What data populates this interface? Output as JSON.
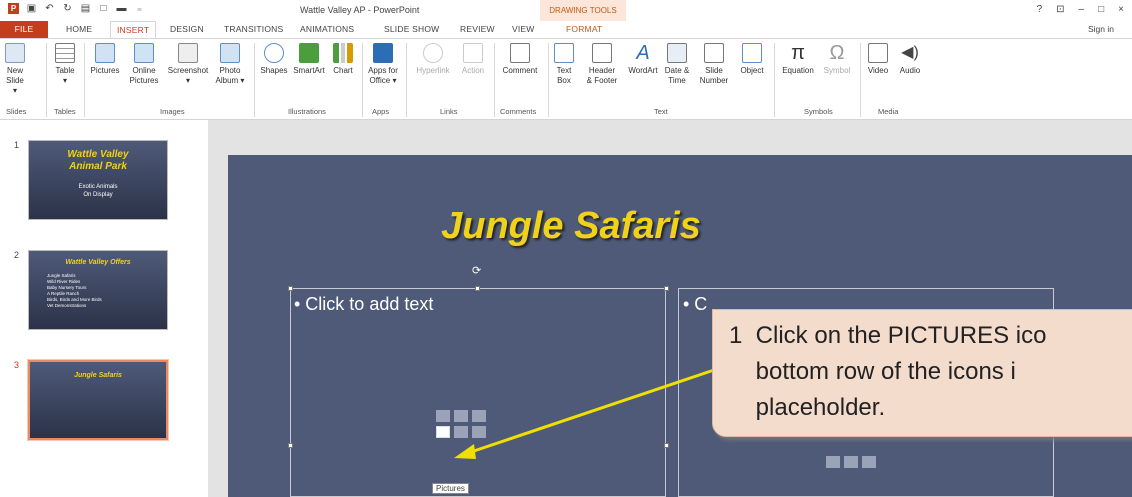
{
  "app": {
    "window_title": "Wattle Valley AP - PowerPoint",
    "contextual_tab_group": "DRAWING TOOLS",
    "sign_in": "Sign in",
    "window_buttons": [
      "?",
      "⊡",
      "–",
      "□",
      "×"
    ]
  },
  "tabs": [
    "FILE",
    "HOME",
    "INSERT",
    "DESIGN",
    "TRANSITIONS",
    "ANIMATIONS",
    "SLIDE SHOW",
    "REVIEW",
    "VIEW",
    "FORMAT"
  ],
  "active_tab": "INSERT",
  "ribbon": {
    "buttons": {
      "new_slide": [
        "New",
        "Slide ▾"
      ],
      "table": [
        "Table",
        "▾"
      ],
      "pictures": "Pictures",
      "online_pictures": [
        "Online",
        "Pictures"
      ],
      "screenshot": [
        "Screenshot",
        "▾"
      ],
      "photo_album": [
        "Photo",
        "Album ▾"
      ],
      "shapes": "Shapes",
      "smartart": "SmartArt",
      "chart": "Chart",
      "apps_for_office": [
        "Apps for",
        "Office ▾"
      ],
      "hyperlink": "Hyperlink",
      "action": "Action",
      "comment": "Comment",
      "text_box": [
        "Text",
        "Box"
      ],
      "header_footer": [
        "Header",
        "& Footer"
      ],
      "wordart": "WordArt",
      "date_time": [
        "Date &",
        "Time"
      ],
      "slide_number": [
        "Slide",
        "Number"
      ],
      "object": "Object",
      "equation": "Equation",
      "symbol": "Symbol",
      "video": "Video",
      "audio": "Audio"
    },
    "groups": [
      "Slides",
      "Tables",
      "Images",
      "Illustrations",
      "Apps",
      "Links",
      "Comments",
      "Text",
      "Symbols",
      "Media"
    ]
  },
  "thumbnails": [
    {
      "num": "1",
      "title": "Wattle Valley\nAnimal Park",
      "sub": "Exotic Animals\nOn Display"
    },
    {
      "num": "2",
      "title": "Wattle Valley Offers",
      "bullets": [
        "Jungle Safaris",
        "Wild River Rides",
        "Baby Nursery Tours",
        "A Reptile Ranch",
        "Birds, Birds and More Birds",
        "Vet Demonstrations"
      ]
    },
    {
      "num": "3",
      "title": "Jungle Safaris"
    }
  ],
  "slide": {
    "title": "Jungle Safaris",
    "left_placeholder": "• Click to add text",
    "right_placeholder": "• C"
  },
  "callout": {
    "line1": "1  Click on the PICTURES ico",
    "line2": "    bottom row of the icons i",
    "line3": "    placeholder."
  },
  "tooltip": "Pictures",
  "colors": {
    "accent": "#c43e1c",
    "slide_bg": "#4e5a78",
    "title": "#f0d21c",
    "callout_bg": "#f4dccd",
    "arrow": "#f0e000"
  }
}
